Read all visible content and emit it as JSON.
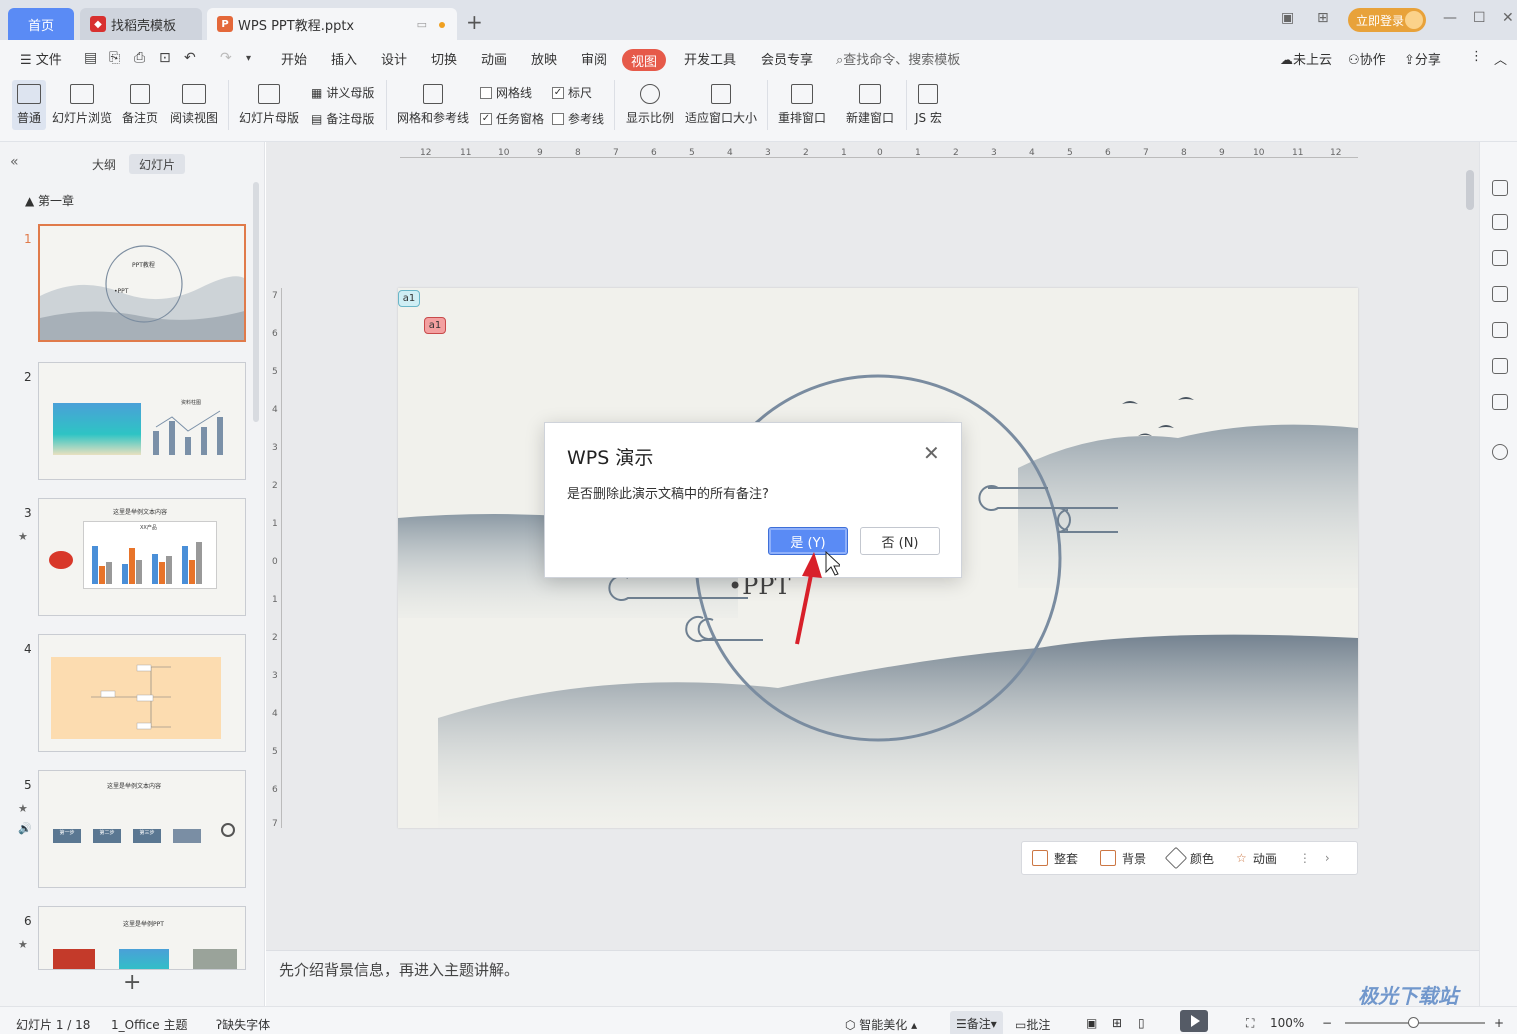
{
  "tabs": {
    "home": "首页",
    "template_tab": "找稻壳模板",
    "doc_tab": "WPS PPT教程.pptx",
    "login": "立即登录"
  },
  "menu": {
    "file": "文件",
    "items": [
      "开始",
      "插入",
      "设计",
      "切换",
      "动画",
      "放映",
      "审阅",
      "视图",
      "开发工具",
      "会员专享"
    ],
    "search": "查找命令、搜索模板",
    "cloud": "未上云",
    "collab": "协作",
    "share": "分享"
  },
  "ribbon": {
    "normal": "普通",
    "slide_browse": "幻灯片浏览",
    "notes_page": "备注页",
    "reading_view": "阅读视图",
    "slide_master": "幻灯片母版",
    "handout_master": "讲义母版",
    "notes_master": "备注母版",
    "grid_guides": "网格和参考线",
    "gridlines": "网格线",
    "ruler": "标尺",
    "task_pane": "任务窗格",
    "guides": "参考线",
    "zoom": "显示比例",
    "fit_window": "适应窗口大小",
    "arrange": "重排窗口",
    "new_window": "新建窗口",
    "macro": "JS 宏"
  },
  "left_panel": {
    "outline_tab": "大纲",
    "slides_tab": "幻灯片",
    "section": "第一章",
    "thumbs": [
      {
        "num": "1",
        "title": "PPT教程",
        "sub": "•PPT"
      },
      {
        "num": "2",
        "title": "资料柱图"
      },
      {
        "num": "3",
        "title": "这里是举例文本内容",
        "sub": "XX产品"
      },
      {
        "num": "4"
      },
      {
        "num": "5",
        "title": "这里是举例文本内容",
        "steps": [
          "第一步",
          "第二步",
          "第三步"
        ]
      },
      {
        "num": "6",
        "title": "这里是举例PPT"
      }
    ]
  },
  "slide": {
    "comment_a": "a1",
    "comment_b": "a1",
    "ppt_text": "•PPT"
  },
  "dialog": {
    "title": "WPS 演示",
    "message": "是否删除此演示文稿中的所有备注?",
    "yes": "是 (Y)",
    "no": "否 (N)"
  },
  "float_tools": {
    "suite": "整套",
    "background": "背景",
    "color": "颜色",
    "animation": "动画"
  },
  "notes_text": "先介绍背景信息，再进入主题讲解。",
  "status": {
    "slide_count": "幻灯片 1 / 18",
    "theme": "1_Office 主题",
    "missing_font": "缺失字体",
    "smart_beautify": "智能美化",
    "notes": "备注",
    "comments": "批注",
    "zoom": "100%"
  },
  "watermark": "极光下载站",
  "colors": {
    "accent_blue": "#5a8bf5",
    "view_tab_red": "#e65a4a",
    "login_orange": "#e8a23a",
    "thumb_selected": "#e07a4a"
  }
}
